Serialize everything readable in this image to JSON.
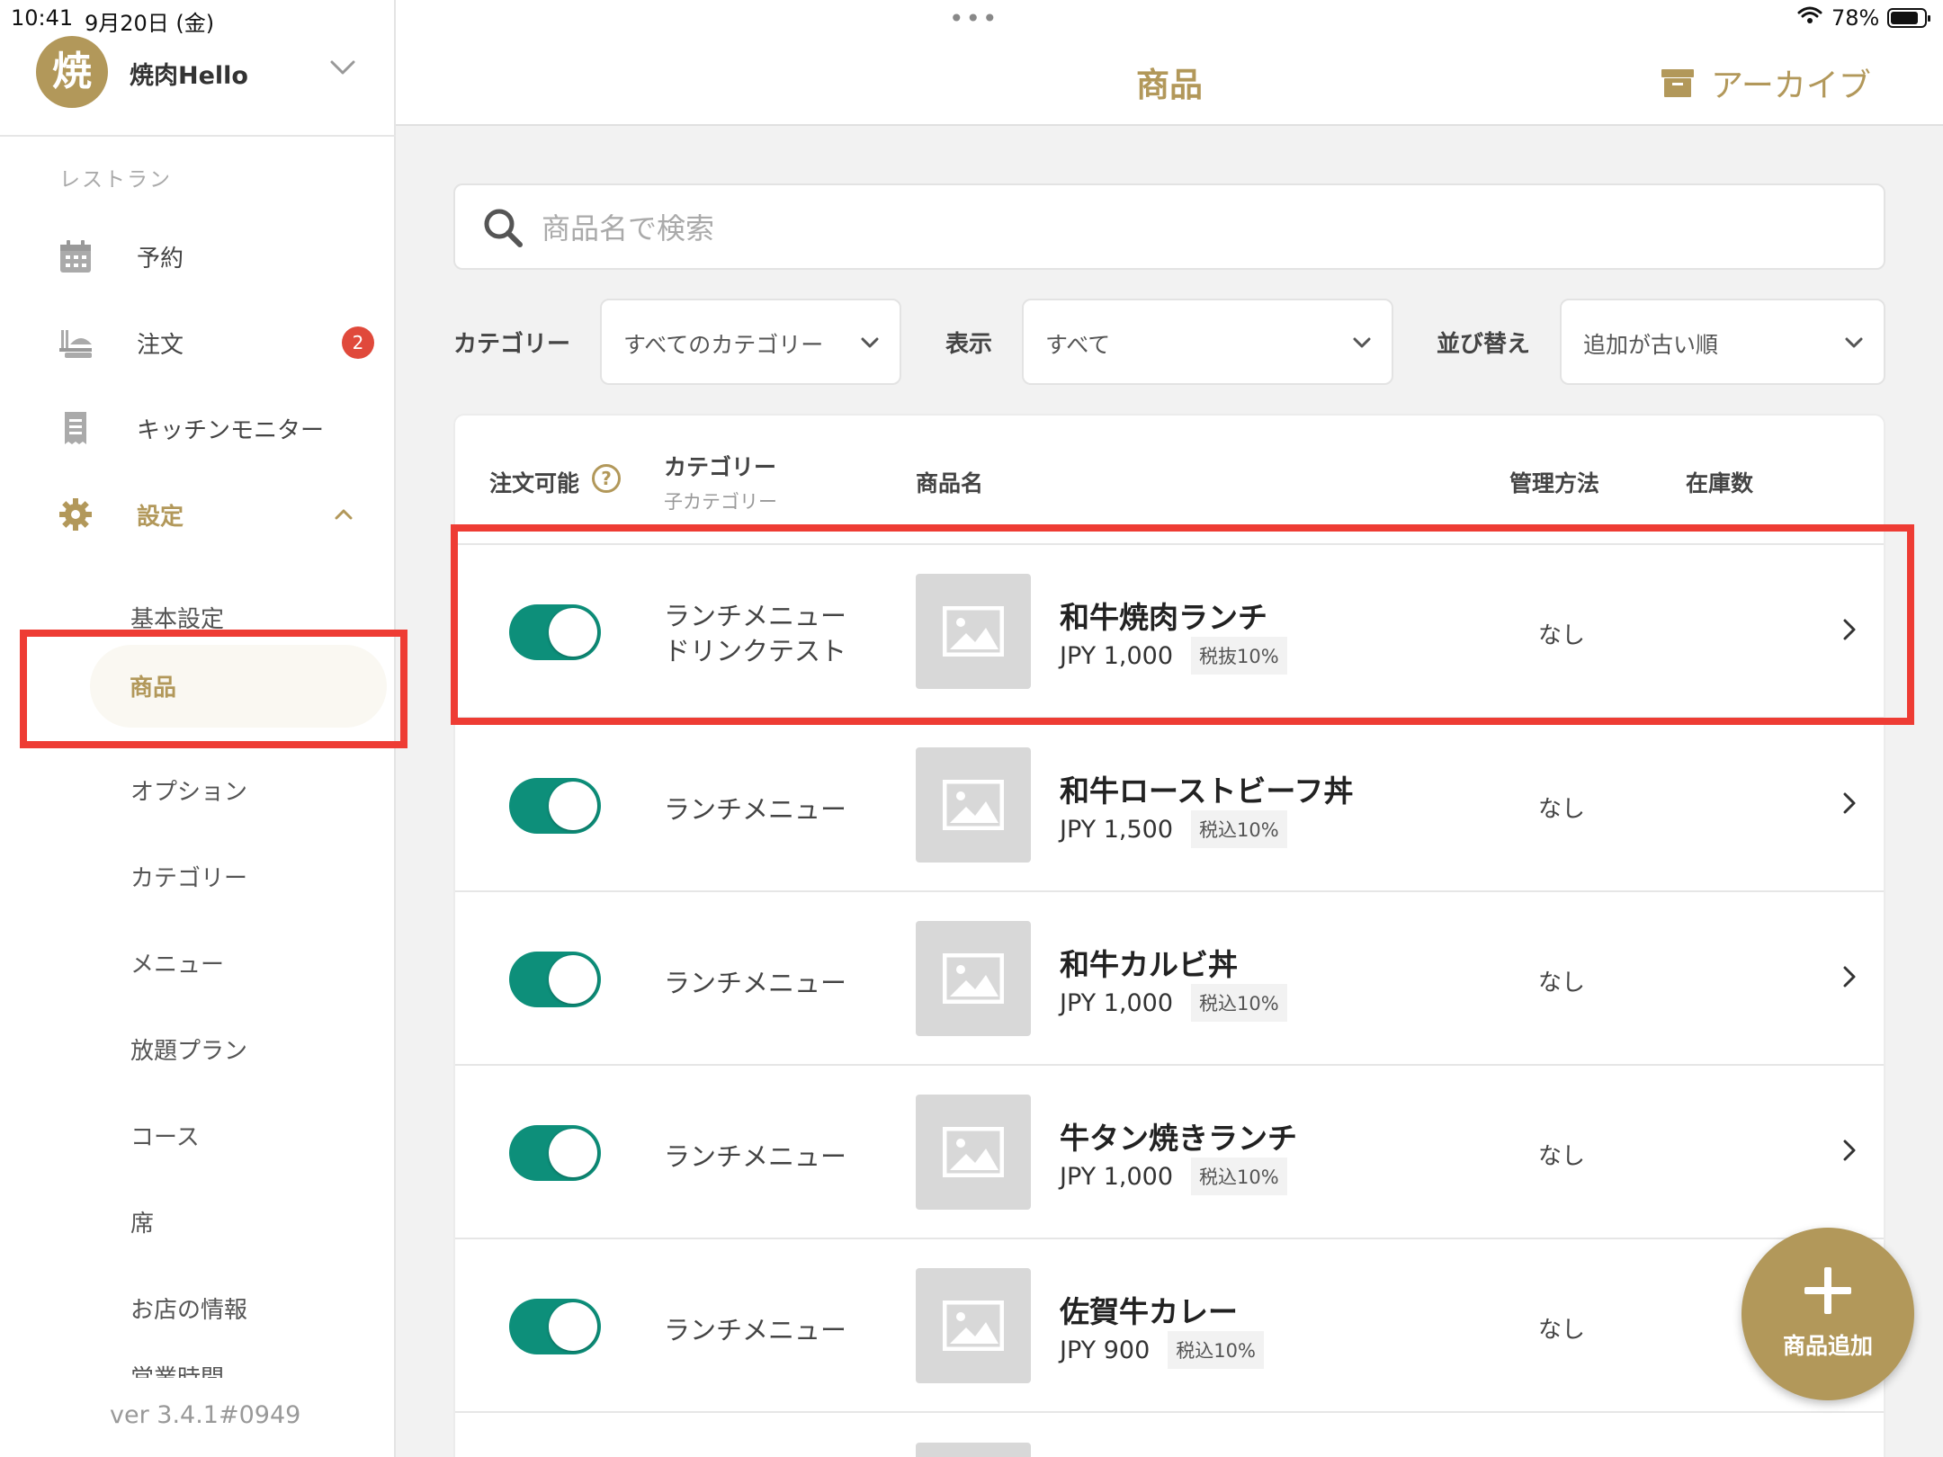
{
  "status_bar": {
    "time": "10:41",
    "date": "9月20日 (金)",
    "battery": "78%"
  },
  "sidebar": {
    "avatar_text": "焼",
    "store_name": "焼肉Hello",
    "section_label": "レストラン",
    "nav": [
      {
        "label": "予約",
        "icon": "calendar-icon"
      },
      {
        "label": "注文",
        "icon": "food-tray-icon",
        "badge": "2"
      },
      {
        "label": "キッチンモニター",
        "icon": "receipt-icon"
      },
      {
        "label": "設定",
        "icon": "gear-icon"
      }
    ],
    "settings_items": [
      {
        "label": "基本設定"
      },
      {
        "label": "商品"
      },
      {
        "label": "オプション"
      },
      {
        "label": "カテゴリー"
      },
      {
        "label": "メニュー"
      },
      {
        "label": "放題プラン"
      },
      {
        "label": "コース"
      },
      {
        "label": "席"
      },
      {
        "label": "お店の情報"
      },
      {
        "label": "営業時間"
      }
    ],
    "version": "ver 3.4.1#0949"
  },
  "header": {
    "title": "商品",
    "archive_label": "アーカイブ"
  },
  "search": {
    "placeholder": "商品名で検索",
    "value": ""
  },
  "filters": {
    "category_label": "カテゴリー",
    "category_value": "すべてのカテゴリー",
    "display_label": "表示",
    "display_value": "すべて",
    "sort_label": "並び替え",
    "sort_value": "追加が古い順"
  },
  "table": {
    "headers": {
      "orderable": "注文可能",
      "category": "カテゴリー",
      "subcategory": "子カテゴリー",
      "name": "商品名",
      "management": "管理方法",
      "stock": "在庫数"
    },
    "rows": [
      {
        "orderable": true,
        "category": "ランチメニュー",
        "category2": "ドリンクテスト",
        "name": "和牛焼肉ランチ",
        "price": "JPY 1,000",
        "tax": "税抜10%",
        "management": "なし"
      },
      {
        "orderable": true,
        "category": "ランチメニュー",
        "category2": "",
        "name": "和牛ローストビーフ丼",
        "price": "JPY 1,500",
        "tax": "税込10%",
        "management": "なし"
      },
      {
        "orderable": true,
        "category": "ランチメニュー",
        "category2": "",
        "name": "和牛カルビ丼",
        "price": "JPY 1,000",
        "tax": "税込10%",
        "management": "なし"
      },
      {
        "orderable": true,
        "category": "ランチメニュー",
        "category2": "",
        "name": "牛タン焼きランチ",
        "price": "JPY 1,000",
        "tax": "税込10%",
        "management": "なし"
      },
      {
        "orderable": true,
        "category": "ランチメニュー",
        "category2": "",
        "name": "佐賀牛カレー",
        "price": "JPY 900",
        "tax": "税込10%",
        "management": "なし"
      }
    ]
  },
  "fab": {
    "label": "商品追加"
  },
  "colors": {
    "accent": "#b2985a",
    "toggle_on": "#0d8f7a",
    "badge": "#e0493b",
    "highlight": "#ee3c34"
  }
}
